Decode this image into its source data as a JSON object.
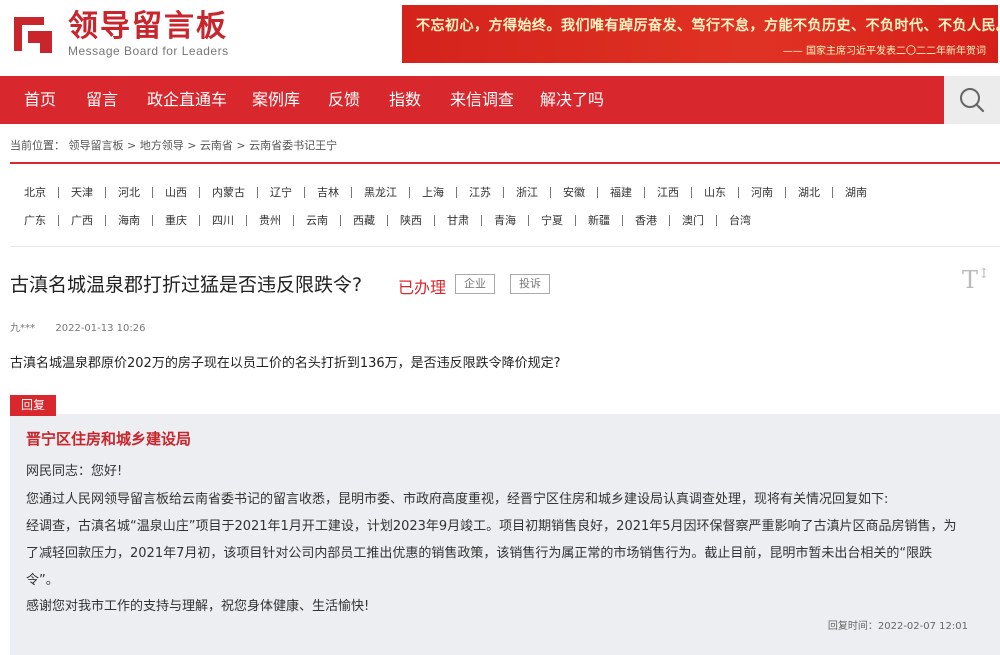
{
  "header": {
    "logo_title": "领导留言板",
    "logo_subtitle": "Message Board for Leaders",
    "banner_slogan": "不忘初心，方得始终。我们唯有踔厉奋发、笃行不怠，方能不负历史、不负时代、不负人民。",
    "banner_attribution": "—— 国家主席习近平发表二〇二二年新年贺词"
  },
  "nav": {
    "items": [
      "首页",
      "留言",
      "政企直通车",
      "案例库",
      "反馈",
      "指数",
      "来信调查",
      "解决了吗"
    ],
    "search_icon": "search-icon"
  },
  "breadcrumb": "当前位置： 领导留言板 > 地方领导 > 云南省 > 云南省委书记王宁",
  "provinces": {
    "row1": [
      "北京",
      "天津",
      "河北",
      "山西",
      "内蒙古",
      "辽宁",
      "吉林",
      "黑龙江",
      "上海",
      "江苏",
      "浙江",
      "安徽",
      "福建",
      "江西",
      "山东",
      "河南",
      "湖北",
      "湖南"
    ],
    "row2": [
      "广东",
      "广西",
      "海南",
      "重庆",
      "四川",
      "贵州",
      "云南",
      "西藏",
      "陕西",
      "甘肃",
      "青海",
      "宁夏",
      "新疆",
      "香港",
      "澳门",
      "台湾"
    ]
  },
  "message": {
    "title": "古滇名城温泉郡打折过猛是否违反限跌令?",
    "status": "已办理",
    "tags": [
      "企业",
      "投诉"
    ],
    "font_size_icon": "font-size-icon",
    "author": "九***",
    "time": "2022-01-13 10:26",
    "body": "古滇名城温泉郡原价202万的房子现在以员工价的名头打折到136万，是否违反限跌令降价规定?"
  },
  "reply": {
    "label": "回复",
    "org": "晋宁区住房和城乡建设局",
    "lines": [
      "网民同志：您好!",
      "您通过人民网领导留言板给云南省委书记的留言收悉，昆明市委、市政府高度重视，经晋宁区住房和城乡建设局认真调查处理，现将有关情况回复如下:",
      "经调查，古滇名城“温泉山庄”项目于2021年1月开工建设，计划2023年9月竣工。项目初期销售良好，2021年5月因环保督察严重影响了古滇片区商品房销售，为",
      "了减轻回款压力，2021年7月初，该项目针对公司内部员工推出优惠的销售政策，该销售行为属正常的市场销售行为。截止目前，昆明市暂未出台相关的“限跌",
      "令”。",
      "感谢您对我市工作的支持与理解，祝您身体健康、生活愉快!"
    ],
    "time": "回复时间：2022-02-07 12:01"
  },
  "colors": {
    "brand_red": "#d8282e",
    "reply_bg": "#eceef2"
  }
}
